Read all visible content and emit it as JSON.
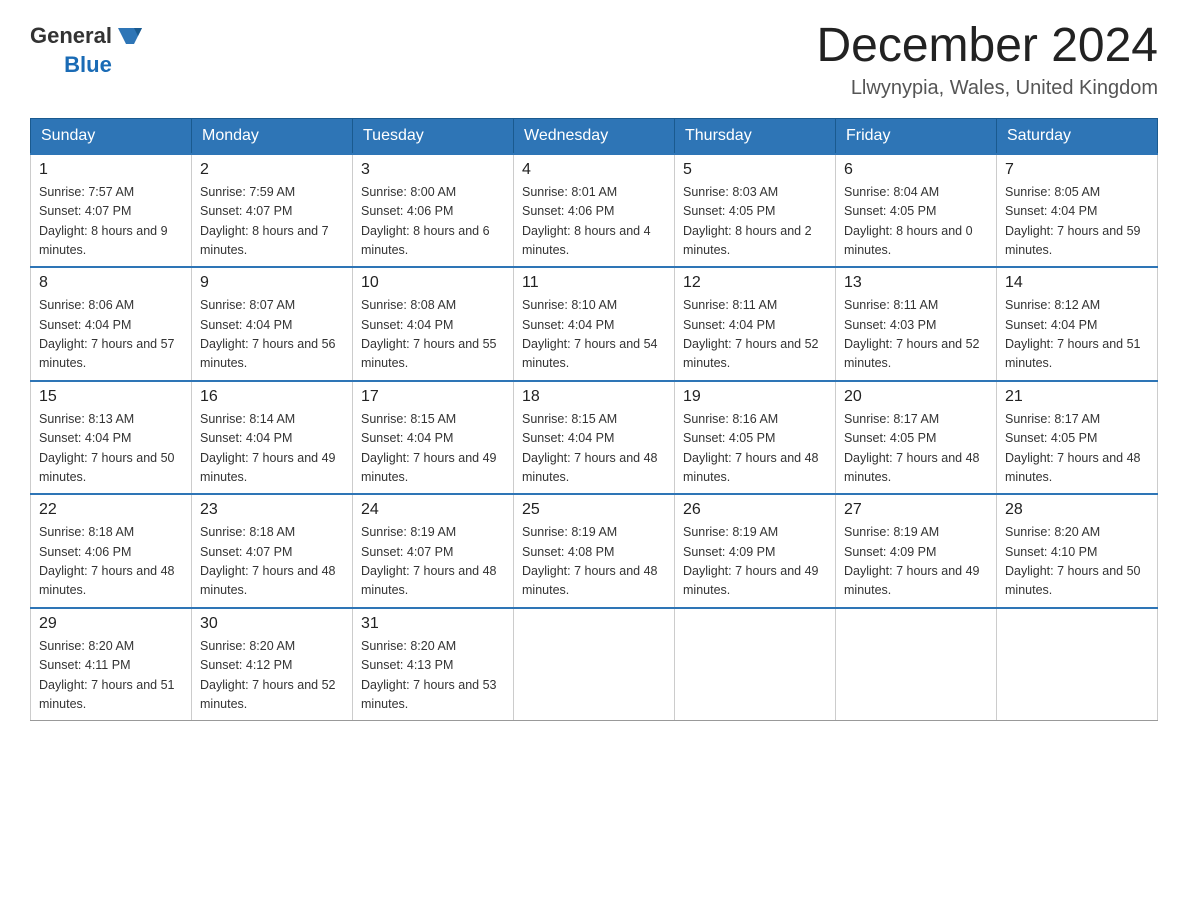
{
  "header": {
    "logo": {
      "text_general": "General",
      "text_blue": "Blue"
    },
    "title": "December 2024",
    "subtitle": "Llwynypia, Wales, United Kingdom"
  },
  "calendar": {
    "days_of_week": [
      "Sunday",
      "Monday",
      "Tuesday",
      "Wednesday",
      "Thursday",
      "Friday",
      "Saturday"
    ],
    "weeks": [
      [
        {
          "day": "1",
          "sunrise": "7:57 AM",
          "sunset": "4:07 PM",
          "daylight": "8 hours and 9 minutes."
        },
        {
          "day": "2",
          "sunrise": "7:59 AM",
          "sunset": "4:07 PM",
          "daylight": "8 hours and 7 minutes."
        },
        {
          "day": "3",
          "sunrise": "8:00 AM",
          "sunset": "4:06 PM",
          "daylight": "8 hours and 6 minutes."
        },
        {
          "day": "4",
          "sunrise": "8:01 AM",
          "sunset": "4:06 PM",
          "daylight": "8 hours and 4 minutes."
        },
        {
          "day": "5",
          "sunrise": "8:03 AM",
          "sunset": "4:05 PM",
          "daylight": "8 hours and 2 minutes."
        },
        {
          "day": "6",
          "sunrise": "8:04 AM",
          "sunset": "4:05 PM",
          "daylight": "8 hours and 0 minutes."
        },
        {
          "day": "7",
          "sunrise": "8:05 AM",
          "sunset": "4:04 PM",
          "daylight": "7 hours and 59 minutes."
        }
      ],
      [
        {
          "day": "8",
          "sunrise": "8:06 AM",
          "sunset": "4:04 PM",
          "daylight": "7 hours and 57 minutes."
        },
        {
          "day": "9",
          "sunrise": "8:07 AM",
          "sunset": "4:04 PM",
          "daylight": "7 hours and 56 minutes."
        },
        {
          "day": "10",
          "sunrise": "8:08 AM",
          "sunset": "4:04 PM",
          "daylight": "7 hours and 55 minutes."
        },
        {
          "day": "11",
          "sunrise": "8:10 AM",
          "sunset": "4:04 PM",
          "daylight": "7 hours and 54 minutes."
        },
        {
          "day": "12",
          "sunrise": "8:11 AM",
          "sunset": "4:04 PM",
          "daylight": "7 hours and 52 minutes."
        },
        {
          "day": "13",
          "sunrise": "8:11 AM",
          "sunset": "4:03 PM",
          "daylight": "7 hours and 52 minutes."
        },
        {
          "day": "14",
          "sunrise": "8:12 AM",
          "sunset": "4:04 PM",
          "daylight": "7 hours and 51 minutes."
        }
      ],
      [
        {
          "day": "15",
          "sunrise": "8:13 AM",
          "sunset": "4:04 PM",
          "daylight": "7 hours and 50 minutes."
        },
        {
          "day": "16",
          "sunrise": "8:14 AM",
          "sunset": "4:04 PM",
          "daylight": "7 hours and 49 minutes."
        },
        {
          "day": "17",
          "sunrise": "8:15 AM",
          "sunset": "4:04 PM",
          "daylight": "7 hours and 49 minutes."
        },
        {
          "day": "18",
          "sunrise": "8:15 AM",
          "sunset": "4:04 PM",
          "daylight": "7 hours and 48 minutes."
        },
        {
          "day": "19",
          "sunrise": "8:16 AM",
          "sunset": "4:05 PM",
          "daylight": "7 hours and 48 minutes."
        },
        {
          "day": "20",
          "sunrise": "8:17 AM",
          "sunset": "4:05 PM",
          "daylight": "7 hours and 48 minutes."
        },
        {
          "day": "21",
          "sunrise": "8:17 AM",
          "sunset": "4:05 PM",
          "daylight": "7 hours and 48 minutes."
        }
      ],
      [
        {
          "day": "22",
          "sunrise": "8:18 AM",
          "sunset": "4:06 PM",
          "daylight": "7 hours and 48 minutes."
        },
        {
          "day": "23",
          "sunrise": "8:18 AM",
          "sunset": "4:07 PM",
          "daylight": "7 hours and 48 minutes."
        },
        {
          "day": "24",
          "sunrise": "8:19 AM",
          "sunset": "4:07 PM",
          "daylight": "7 hours and 48 minutes."
        },
        {
          "day": "25",
          "sunrise": "8:19 AM",
          "sunset": "4:08 PM",
          "daylight": "7 hours and 48 minutes."
        },
        {
          "day": "26",
          "sunrise": "8:19 AM",
          "sunset": "4:09 PM",
          "daylight": "7 hours and 49 minutes."
        },
        {
          "day": "27",
          "sunrise": "8:19 AM",
          "sunset": "4:09 PM",
          "daylight": "7 hours and 49 minutes."
        },
        {
          "day": "28",
          "sunrise": "8:20 AM",
          "sunset": "4:10 PM",
          "daylight": "7 hours and 50 minutes."
        }
      ],
      [
        {
          "day": "29",
          "sunrise": "8:20 AM",
          "sunset": "4:11 PM",
          "daylight": "7 hours and 51 minutes."
        },
        {
          "day": "30",
          "sunrise": "8:20 AM",
          "sunset": "4:12 PM",
          "daylight": "7 hours and 52 minutes."
        },
        {
          "day": "31",
          "sunrise": "8:20 AM",
          "sunset": "4:13 PM",
          "daylight": "7 hours and 53 minutes."
        },
        null,
        null,
        null,
        null
      ]
    ]
  }
}
